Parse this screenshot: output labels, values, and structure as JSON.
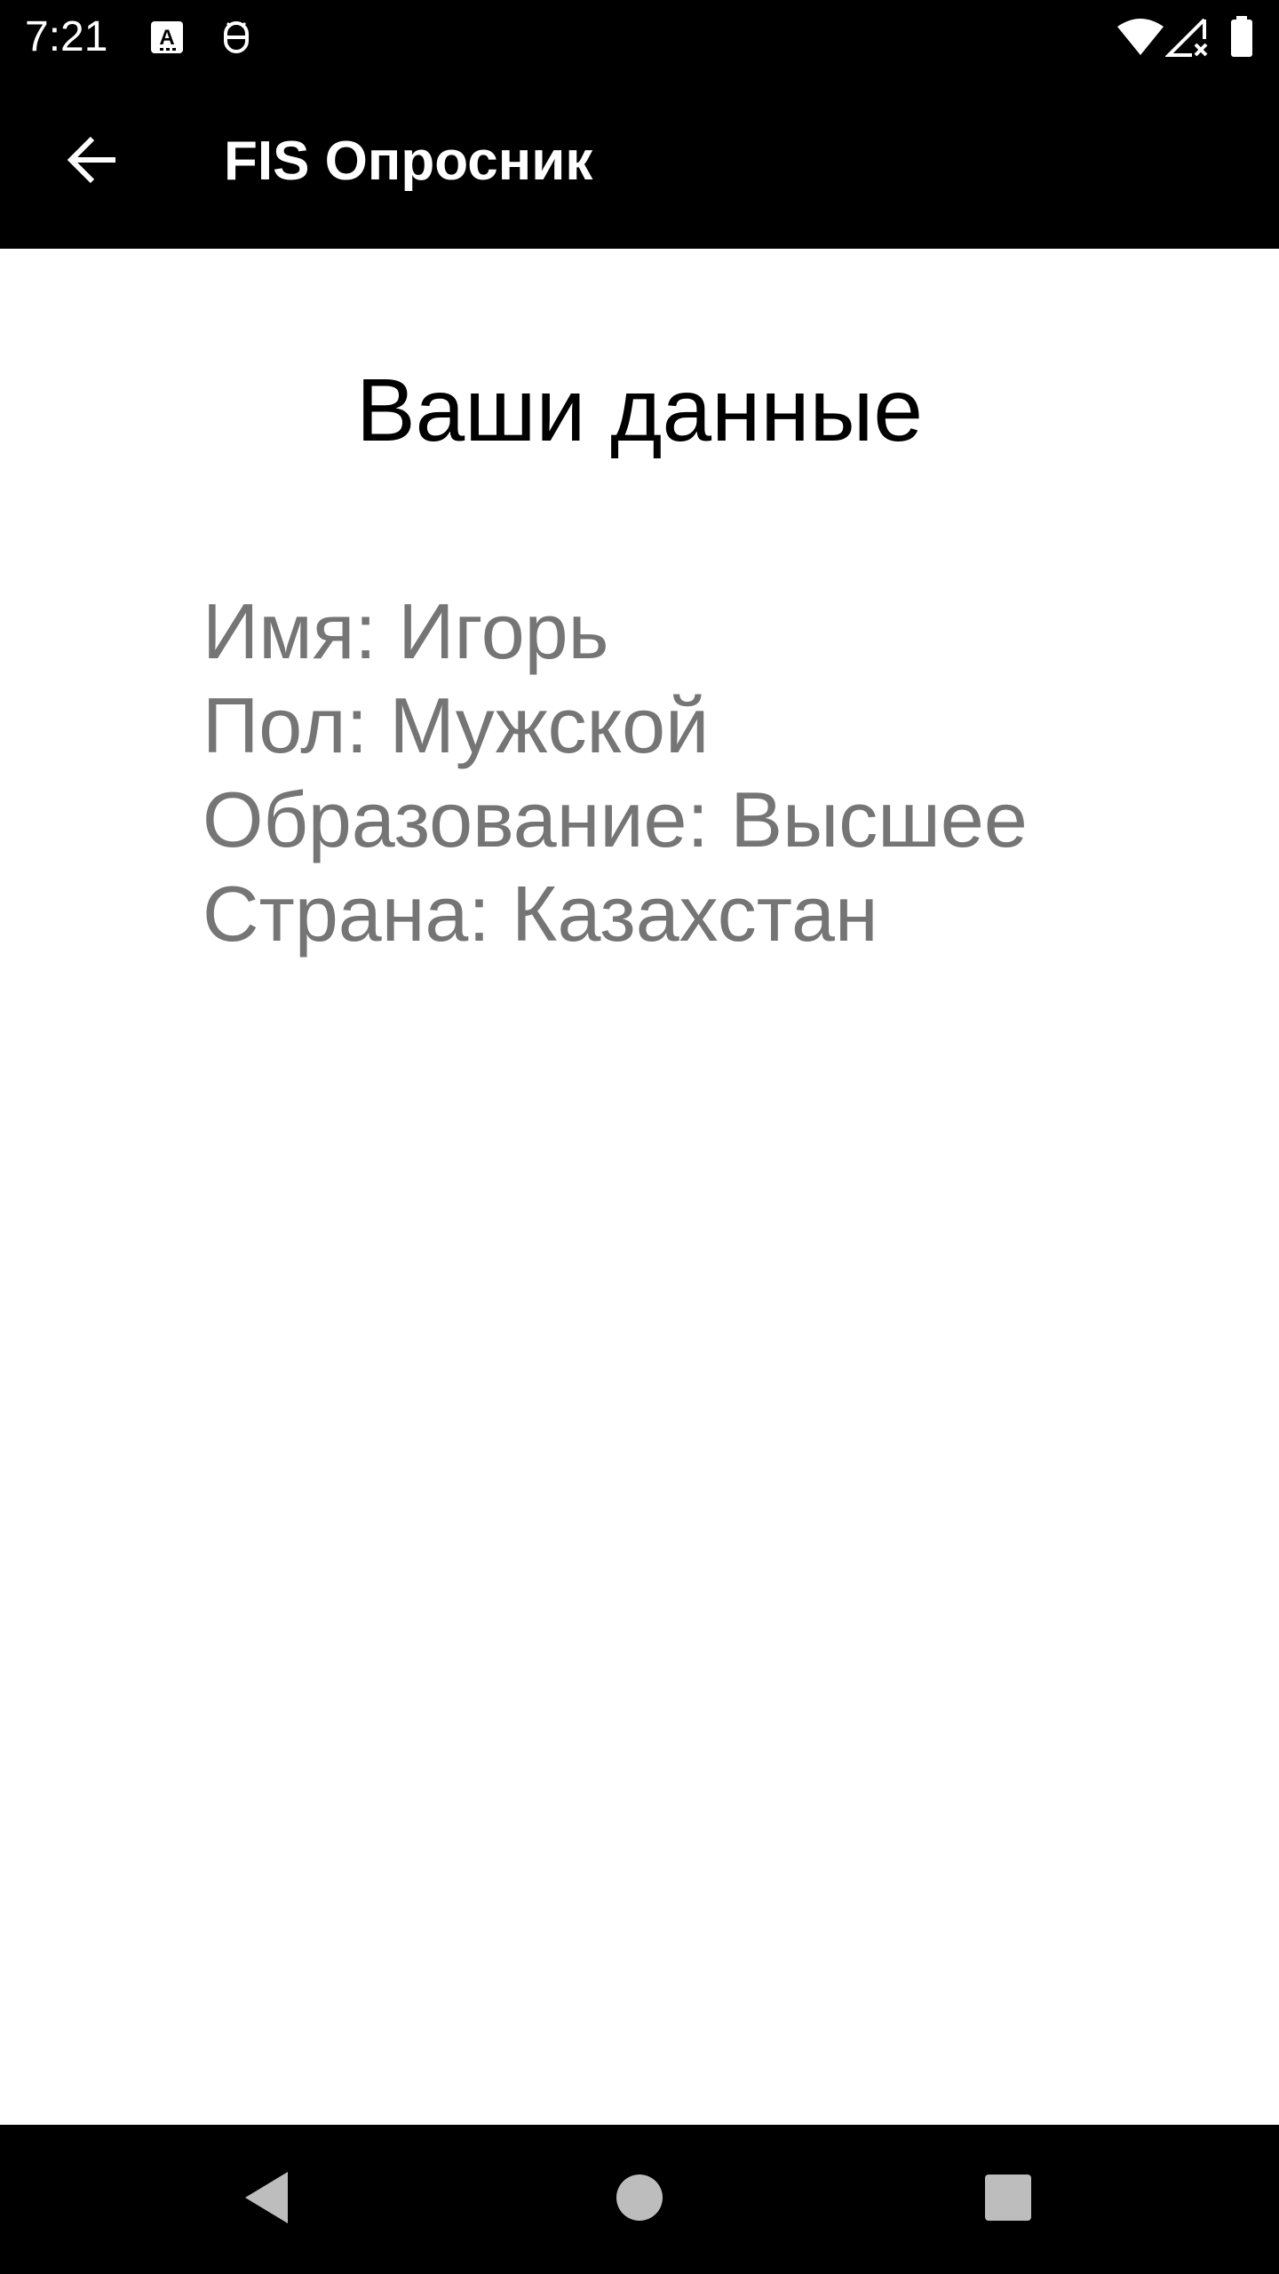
{
  "status_bar": {
    "time": "7:21",
    "icons": [
      "keyboard-a-icon",
      "android-debug-icon",
      "wifi-icon",
      "signal-off-icon",
      "battery-full-icon"
    ]
  },
  "app_bar": {
    "back_icon": "arrow-back-icon",
    "title": "FIS Опросник"
  },
  "main": {
    "heading": "Ваши данные",
    "info_lines": [
      "Имя: Игорь",
      "Пол: Мужской",
      "Образование: Высшее",
      "Страна: Казахстан"
    ]
  },
  "nav_bar": {
    "icons": [
      "nav-back-icon",
      "nav-home-icon",
      "nav-recents-icon"
    ]
  },
  "colors": {
    "bars": "#000000",
    "background": "#ffffff",
    "heading_text": "#000000",
    "info_text": "#757575",
    "nav_icons": "#bdbdbd"
  }
}
